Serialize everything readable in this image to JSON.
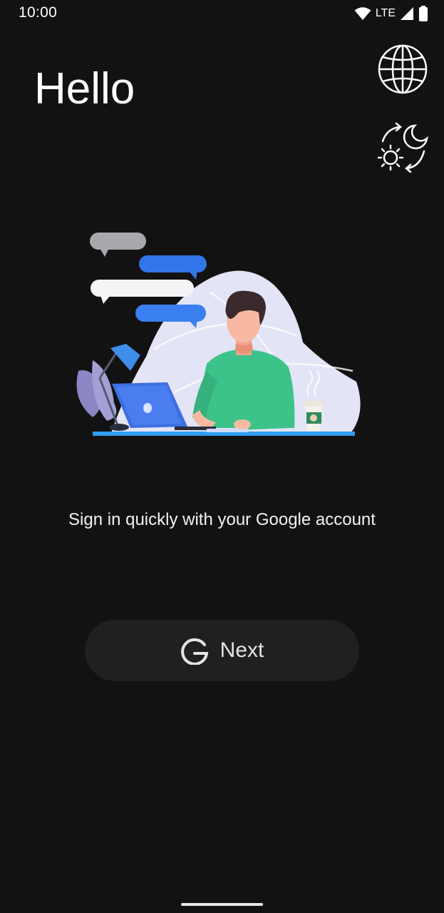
{
  "status_bar": {
    "time": "10:00",
    "network": "LTE",
    "icons": [
      "wifi-icon",
      "lte-signal-icon",
      "battery-icon"
    ]
  },
  "header": {
    "greeting": "Hello",
    "language_button_icon": "globe-icon",
    "theme_button_icon": "day-night-toggle-icon"
  },
  "illustration": {
    "name": "person-typing-on-laptop-with-chat-bubbles"
  },
  "main": {
    "description": "Sign in quickly with your Google account",
    "next_button": {
      "icon": "google-g-icon",
      "label": "Next"
    }
  },
  "colors": {
    "background": "#121212",
    "button_background": "#202020",
    "accent_blue": "#2F80ED",
    "text": "#FFFFFF"
  }
}
